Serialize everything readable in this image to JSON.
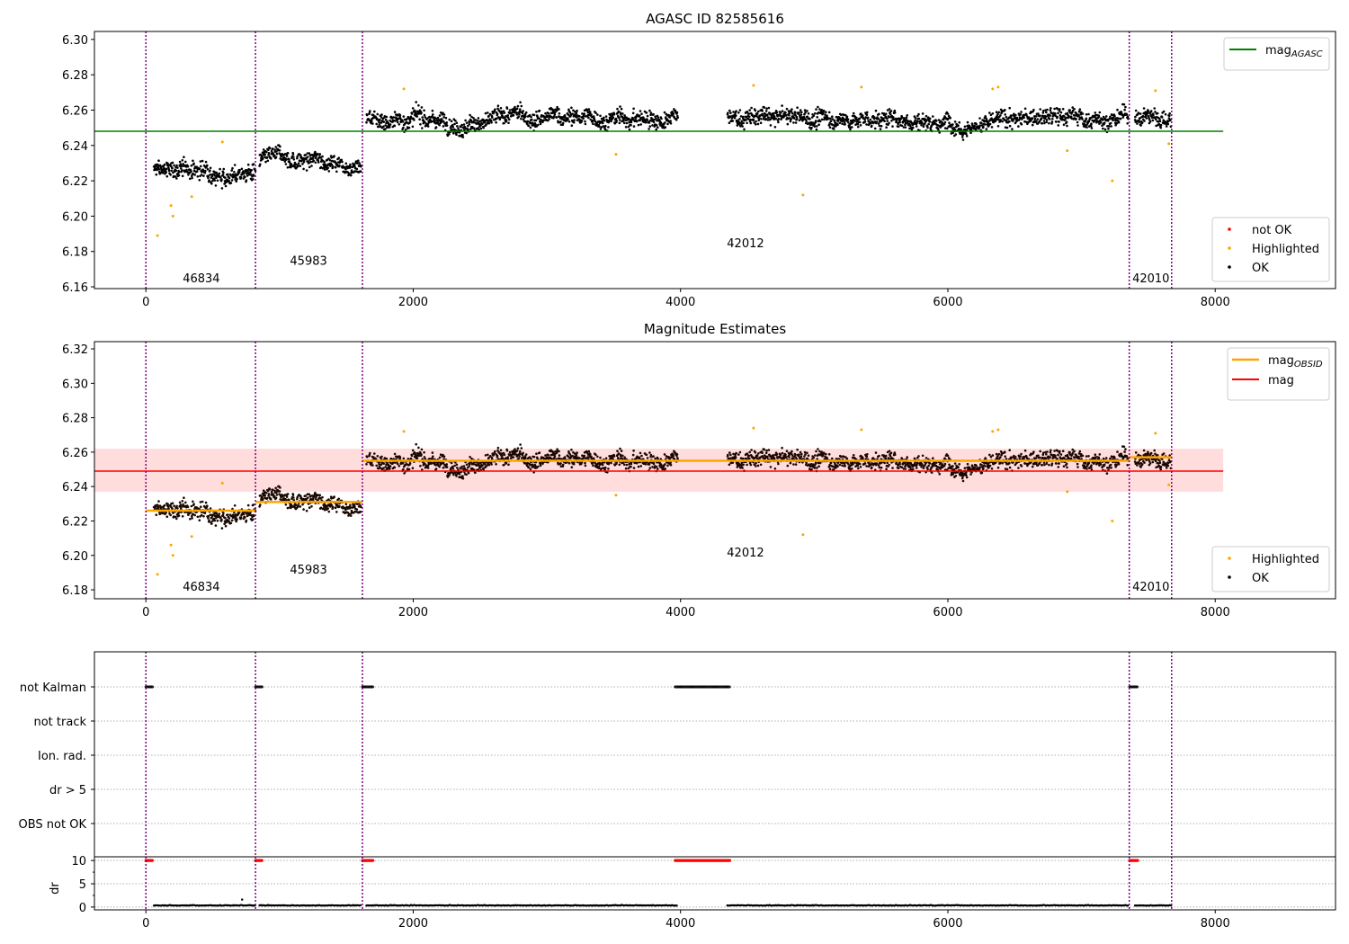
{
  "chart_data": [
    {
      "type": "scatter",
      "title": "AGASC ID 82585616",
      "xlim": [
        -385,
        8900
      ],
      "ylim": [
        6.159,
        6.3045
      ],
      "xticks": [
        "0",
        "2000",
        "4000",
        "6000",
        "8000"
      ],
      "yticks": [
        "6.16",
        "6.18",
        "6.20",
        "6.22",
        "6.24",
        "6.26",
        "6.28",
        "6.30"
      ],
      "mag_agasc": 6.248,
      "legend_lines": [
        {
          "label": "mag",
          "sub": "AGASC",
          "color": "#008000"
        }
      ],
      "legend_points": [
        {
          "label": "not OK",
          "color": "#ff0000"
        },
        {
          "label": "Highlighted",
          "color": "#ffa500"
        },
        {
          "label": "OK",
          "color": "#000000"
        }
      ],
      "obsid_labels": [
        {
          "text": "46834",
          "x": 415,
          "y": 6.165
        },
        {
          "text": "45983",
          "x": 1217,
          "y": 6.175
        },
        {
          "text": "42012",
          "x": 4486,
          "y": 6.185
        },
        {
          "text": "42010",
          "x": 7519,
          "y": 6.165
        }
      ]
    },
    {
      "type": "scatter",
      "title": "Magnitude Estimates",
      "xlim": [
        -385,
        8900
      ],
      "ylim": [
        6.1748,
        6.3242
      ],
      "xticks": [
        "0",
        "2000",
        "4000",
        "6000",
        "8000"
      ],
      "yticks": [
        "6.18",
        "6.20",
        "6.22",
        "6.24",
        "6.26",
        "6.28",
        "6.30",
        "6.32"
      ],
      "mag": 6.249,
      "mag_band": [
        6.237,
        6.262
      ],
      "legend_lines": [
        {
          "label": "mag",
          "sub": "OBSID",
          "color": "#ffa500"
        },
        {
          "label": "mag",
          "sub": "",
          "color": "#ff0000"
        }
      ],
      "legend_points": [
        {
          "label": "Highlighted",
          "color": "#ffa500"
        },
        {
          "label": "OK",
          "color": "#000000"
        }
      ],
      "obsid_labels": [
        {
          "text": "46834",
          "x": 415,
          "y": 6.182
        },
        {
          "text": "45983",
          "x": 1217,
          "y": 6.192
        },
        {
          "text": "42012",
          "x": 4486,
          "y": 6.202
        },
        {
          "text": "42010",
          "x": 7519,
          "y": 6.182
        }
      ]
    },
    {
      "type": "scatter",
      "title": "",
      "xlim": [
        -385,
        8900
      ],
      "xticks": [
        "0",
        "2000",
        "4000",
        "6000",
        "8000"
      ],
      "flag_categories": [
        "not Kalman",
        "not track",
        "Ion. rad.",
        "dr > 5",
        "OBS not OK"
      ],
      "not_kalman_ranges": [
        [
          0,
          50
        ],
        [
          820,
          870
        ],
        [
          1620,
          1700
        ],
        [
          3960,
          4370
        ],
        [
          7360,
          7420
        ]
      ],
      "dr_ylabel": "dr",
      "dr_ylim": [
        -0.6,
        10.8
      ],
      "dr_yticks": [
        "0",
        "5",
        "10"
      ],
      "dr_flagged_value": 10,
      "dr_typical": 0.3
    }
  ],
  "obsids": [
    {
      "obsid": "46834",
      "start": 0,
      "stop": 820,
      "data_start": 60,
      "data_stop": 820,
      "mean": 6.226
    },
    {
      "obsid": "45983",
      "start": 820,
      "stop": 1620,
      "data_start": 850,
      "data_stop": 1610,
      "mean": 6.231
    },
    {
      "obsid": "42012",
      "start": 1620,
      "stop": 7360,
      "data_start": 1650,
      "data_stop": 7350,
      "gap": [
        3980,
        4350
      ],
      "mean": 6.255
    },
    {
      "obsid": "42010",
      "start": 7360,
      "stop": 7674,
      "data_start": 7400,
      "data_stop": 7670,
      "mean": 6.257
    }
  ],
  "highlighted_points": [
    [
      87,
      6.189
    ],
    [
      188,
      6.206
    ],
    [
      202,
      6.2
    ],
    [
      343,
      6.211
    ],
    [
      572,
      6.242
    ],
    [
      1930,
      6.272
    ],
    [
      3517,
      6.235
    ],
    [
      4546,
      6.274
    ],
    [
      4916,
      6.212
    ],
    [
      5353,
      6.273
    ],
    [
      6335,
      6.272
    ],
    [
      6376,
      6.273
    ],
    [
      6893,
      6.237
    ],
    [
      7230,
      6.22
    ],
    [
      7553,
      6.271
    ],
    [
      7653,
      6.241
    ]
  ],
  "colors": {
    "boundary": "#800080",
    "agasc": "#008000",
    "mag": "#ff0000",
    "band": "#ffdddd",
    "obsid_mean": "#ffa500"
  }
}
